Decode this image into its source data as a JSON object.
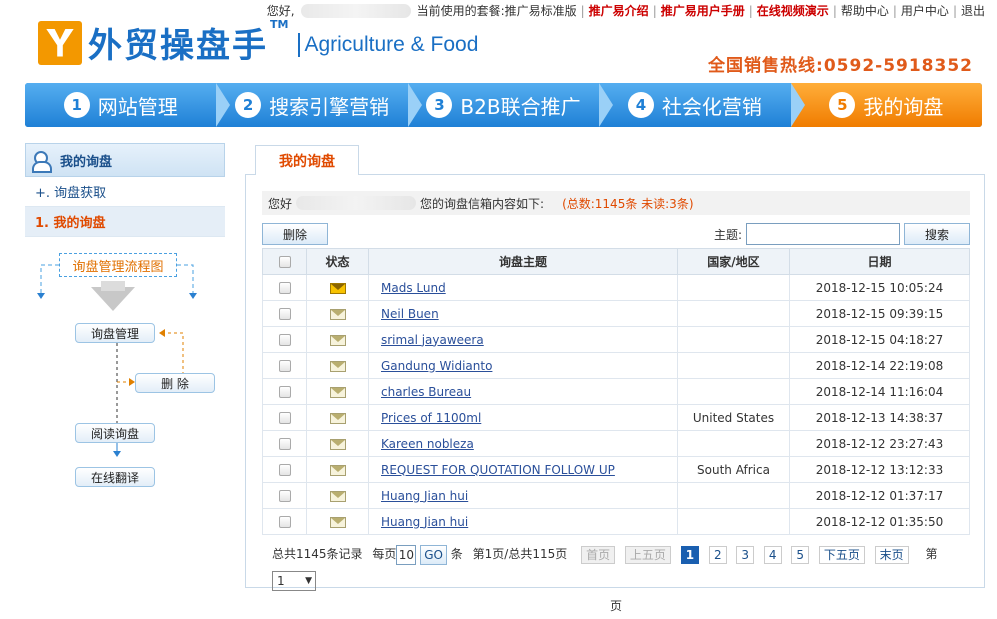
{
  "topbar": {
    "greeting": "您好,",
    "package_label": "当前使用的套餐:",
    "package_value": "推广易标准版",
    "links": [
      "推广易介绍",
      "推广易用户手册",
      "在线视频演示"
    ],
    "plain_links": [
      "帮助中心",
      "用户中心",
      "退出"
    ]
  },
  "logo": {
    "cn": "外贸操盘手",
    "tm": "TM",
    "en": "Agriculture & Food"
  },
  "hotline": "全国销售热线:0592-5918352",
  "nav": [
    {
      "num": "1",
      "label": "网站管理"
    },
    {
      "num": "2",
      "label": "搜索引擎营销"
    },
    {
      "num": "3",
      "label": "B2B联合推广"
    },
    {
      "num": "4",
      "label": "社会化营销"
    },
    {
      "num": "5",
      "label": "我的询盘"
    }
  ],
  "sidebar": {
    "title": "我的询盘",
    "items": [
      "+. 询盘获取",
      "1. 我的询盘"
    ]
  },
  "flow": {
    "title": "询盘管理流程图",
    "manage": "询盘管理",
    "delete": "删 除",
    "read": "阅读询盘",
    "translate": "在线翻译"
  },
  "main": {
    "tab": "我的询盘",
    "info_prefix": "您好",
    "info_suffix": "您的询盘信箱内容如下:",
    "count": "(总数:1145条  未读:3条)",
    "delete_btn": "删除",
    "search_label": "主题:",
    "search_btn": "搜索",
    "search_value": ""
  },
  "table": {
    "headers": [
      "状态",
      "询盘主题",
      "国家/地区",
      "日期"
    ],
    "rows": [
      {
        "unread": true,
        "subject": "Mads Lund",
        "country": "",
        "date": "2018-12-15 10:05:24"
      },
      {
        "unread": false,
        "subject": "Neil Buen",
        "country": "",
        "date": "2018-12-15 09:39:15"
      },
      {
        "unread": false,
        "subject": "srimal jayaweera",
        "country": "",
        "date": "2018-12-15 04:18:27"
      },
      {
        "unread": false,
        "subject": "Gandung Widianto",
        "country": "",
        "date": "2018-12-14 22:19:08"
      },
      {
        "unread": false,
        "subject": "charles Bureau",
        "country": "",
        "date": "2018-12-14 11:16:04"
      },
      {
        "unread": false,
        "subject": "Prices of 1100ml",
        "country": "United States",
        "date": "2018-12-13 14:38:37"
      },
      {
        "unread": false,
        "subject": "Kareen nobleza",
        "country": "",
        "date": "2018-12-12 23:27:43"
      },
      {
        "unread": false,
        "subject": "REQUEST FOR QUOTATION FOLLOW UP",
        "country": "South Africa",
        "date": "2018-12-12 13:12:33"
      },
      {
        "unread": false,
        "subject": "Huang Jian hui",
        "country": "",
        "date": "2018-12-12 01:37:17"
      },
      {
        "unread": false,
        "subject": "Huang Jian hui",
        "country": "",
        "date": "2018-12-12 01:35:50"
      }
    ]
  },
  "pager": {
    "total": "总共1145条记录",
    "per_label": "每页",
    "per_value": "10",
    "go": "GO",
    "per_unit": "条",
    "page_info": "第1页/总共115页",
    "first": "首页",
    "prev5": "上五页",
    "pages": [
      "1",
      "2",
      "3",
      "4",
      "5"
    ],
    "next5": "下五页",
    "last": "末页",
    "jump_label": "第",
    "jump_value": "1",
    "jump_unit": "页"
  }
}
